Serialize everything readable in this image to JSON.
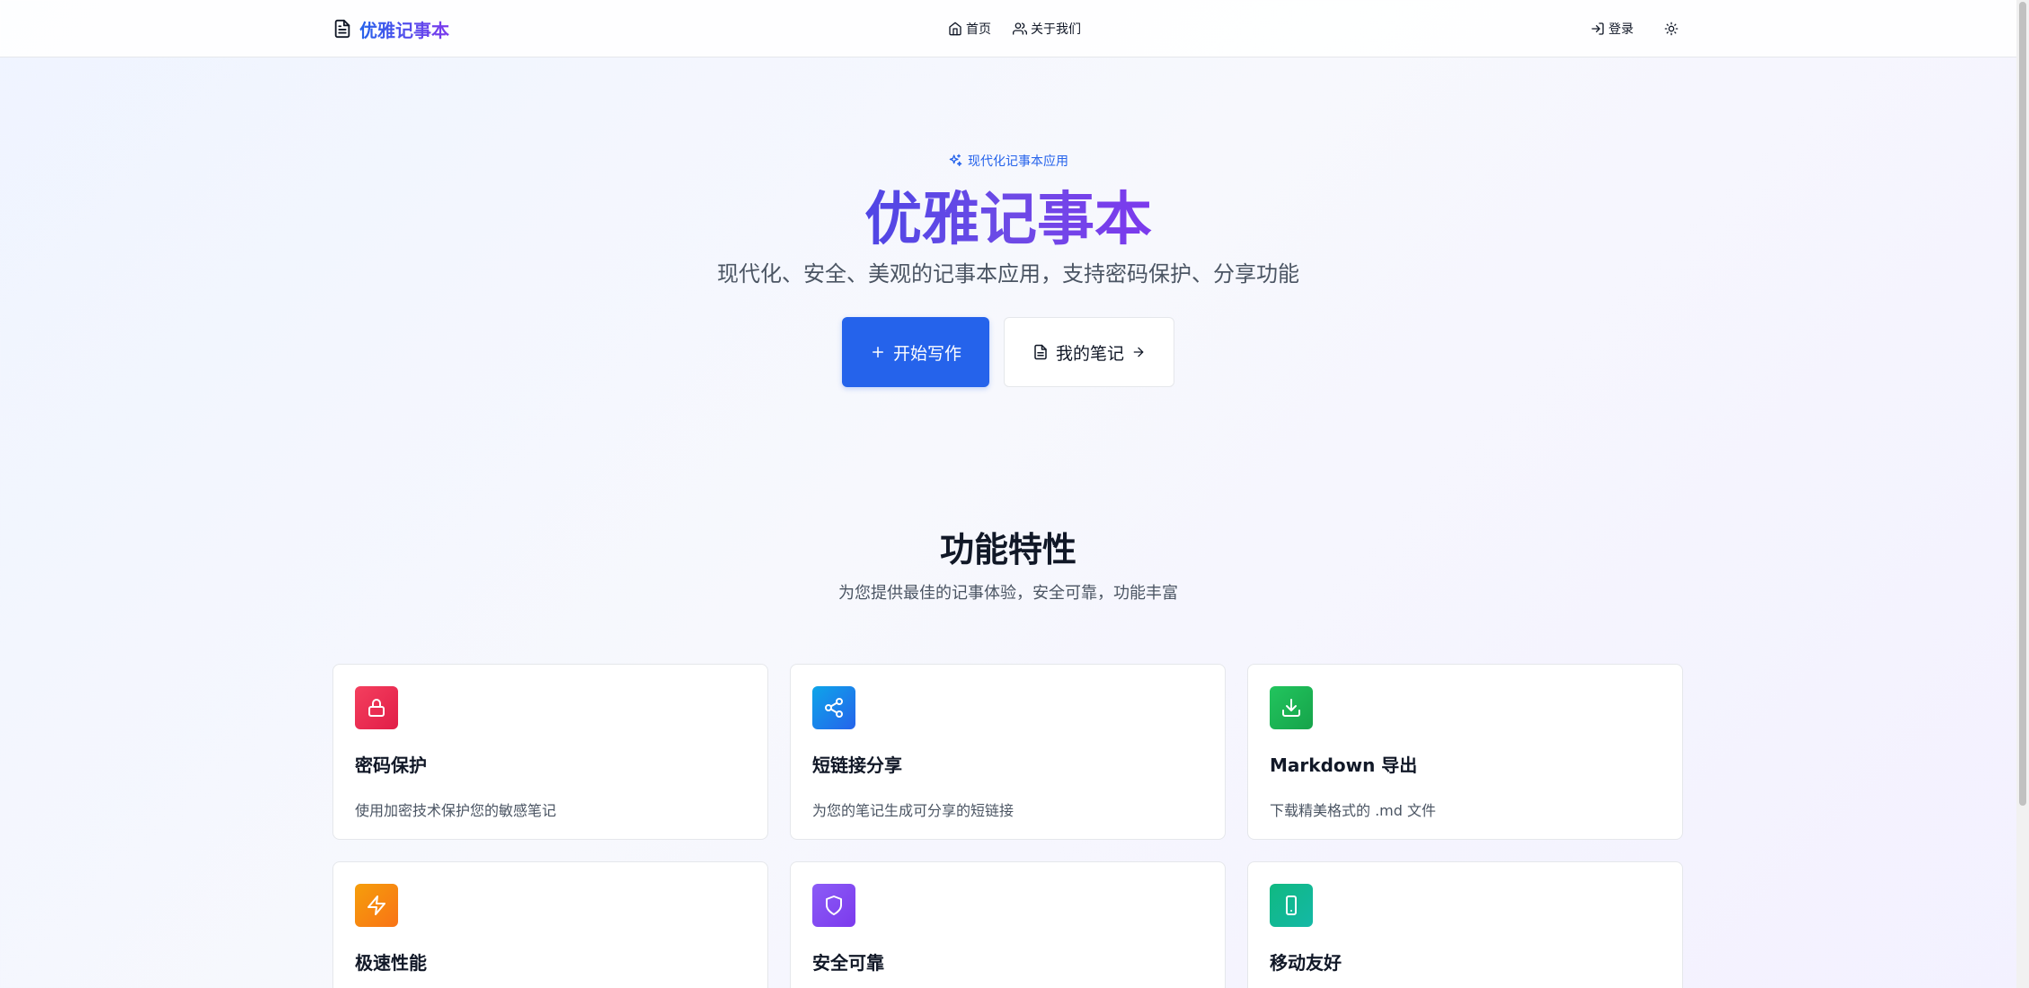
{
  "header": {
    "logo_text": "优雅记事本",
    "nav": [
      {
        "label": "首页",
        "icon": "home-icon"
      },
      {
        "label": "关于我们",
        "icon": "users-icon"
      }
    ],
    "login_label": "登录",
    "theme_icon": "sun-icon"
  },
  "hero": {
    "badge": "现代化记事本应用",
    "title": "优雅记事本",
    "subtitle": "现代化、安全、美观的记事本应用，支持密码保护、分享功能",
    "primary_button": "开始写作",
    "secondary_button": "我的笔记"
  },
  "features": {
    "title": "功能特性",
    "subtitle": "为您提供最佳的记事体验，安全可靠，功能丰富",
    "items": [
      {
        "title": "密码保护",
        "desc": "使用加密技术保护您的敏感笔记",
        "icon": "lock-icon",
        "color": "#f43f5e"
      },
      {
        "title": "短链接分享",
        "desc": "为您的笔记生成可分享的短链接",
        "icon": "share-icon",
        "color": "#0ea5e9"
      },
      {
        "title": "Markdown 导出",
        "desc": "下载精美格式的 .md 文件",
        "icon": "download-icon",
        "color": "#22c55e"
      },
      {
        "title": "极速性能",
        "desc": "",
        "icon": "zap-icon",
        "color": "#f59e0b"
      },
      {
        "title": "安全可靠",
        "desc": "",
        "icon": "shield-icon",
        "color": "#8b5cf6"
      },
      {
        "title": "移动友好",
        "desc": "",
        "icon": "smartphone-icon",
        "color": "#10b981"
      }
    ]
  },
  "colors": {
    "primary": "#2563eb",
    "brand_gradient_start": "#2563eb",
    "brand_gradient_end": "#7c3aed"
  }
}
